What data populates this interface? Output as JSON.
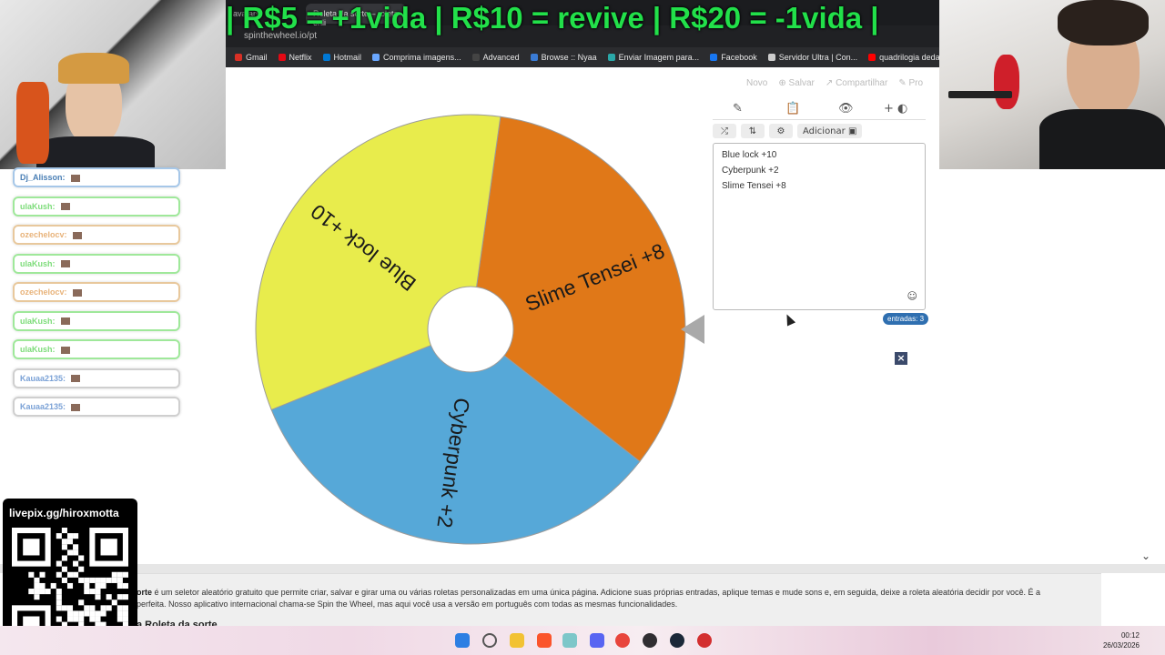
{
  "overlay_banner": "| R$5 = +1vida | R$10 = revive | R$20 = -1vida |",
  "browser": {
    "tabs": [
      {
        "label": "Roleta da sorte – roleta onli",
        "active": true
      },
      {
        "label": "avatars",
        "active": false
      }
    ],
    "url": "spinthewheel.io/pt",
    "bookmarks": [
      {
        "label": "Gmail",
        "color": "#d93025"
      },
      {
        "label": "Netflix",
        "color": "#e50914"
      },
      {
        "label": "Hotmail",
        "color": "#0078d4"
      },
      {
        "label": "Comprima imagens...",
        "color": "#6aa7ff"
      },
      {
        "label": "Advanced",
        "color": "#444444"
      },
      {
        "label": "Browse :: Nyaa",
        "color": "#3a7bd5"
      },
      {
        "label": "Enviar Imagem para...",
        "color": "#2aa8a8"
      },
      {
        "label": "Facebook",
        "color": "#1877f2"
      },
      {
        "label": "Servidor Ultra | Con...",
        "color": "#cccccc"
      },
      {
        "label": "quadrilogia dedadá...",
        "color": "#ff0000"
      }
    ]
  },
  "site_menu": {
    "new": "Novo",
    "save": "Salvar",
    "share": "Compartilhar",
    "pro": "Pro"
  },
  "chat": [
    {
      "user": "Dj_Alisson:",
      "msg": "",
      "style": "blue"
    },
    {
      "user": "ulaKush:",
      "msg": "",
      "style": "green"
    },
    {
      "user": "ozechelocv:",
      "msg": "",
      "style": "orange"
    },
    {
      "user": "ulaKush:",
      "msg": "",
      "style": "green"
    },
    {
      "user": "ozechelocv:",
      "msg": "",
      "style": "orange"
    },
    {
      "user": "ulaKush:",
      "msg": "",
      "style": "green"
    },
    {
      "user": "ulaKush:",
      "msg": "",
      "style": "green"
    },
    {
      "user": "Kauaa2135:",
      "msg": "",
      "style": "gray"
    },
    {
      "user": "Kauaa2135:",
      "msg": "",
      "style": "gray"
    }
  ],
  "wheel": {
    "segments": [
      {
        "label": "Slime Tensei +8",
        "color": "#e07818"
      },
      {
        "label": "Cyberpunk +2",
        "color": "#56a8d8"
      },
      {
        "label": "Blue lock +10",
        "color": "#e8ec4c"
      }
    ]
  },
  "panel": {
    "tools": {
      "add_label": "Adicionar"
    },
    "entries": [
      "Blue lock +10",
      "Cyberpunk +2",
      "Slime Tensei +8"
    ],
    "count_label": "entradas: 3"
  },
  "description": {
    "bold_word": "orte",
    "text": " é um seletor aleatório gratuito que permite criar, salvar e girar uma ou várias roletas personalizadas em uma única página. Adicione suas próprias entradas, aplique temas e mude sons e, em seguida, deixe a roleta aleatória decidir por você. É a",
    "text2": "perfeita. Nosso aplicativo internacional chama-se Spin the Wheel, mas aqui você usa a versão em português com todas as mesmas funcionalidades.",
    "heading": "a Roleta da sorte"
  },
  "qr": {
    "title": "livepix.gg/hiroxmotta"
  },
  "taskbar": {
    "time": "00:12",
    "date": "26/03/2026"
  }
}
